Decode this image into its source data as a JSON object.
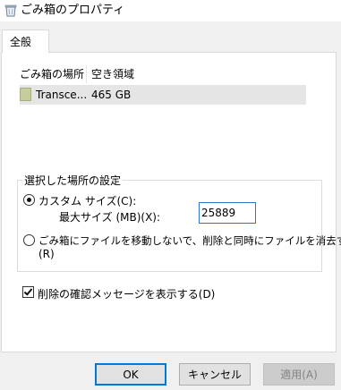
{
  "window": {
    "title": "ごみ箱のプロパティ",
    "icon": "recycle-bin-icon"
  },
  "tabs": [
    {
      "label": "全般",
      "selected": true
    }
  ],
  "list": {
    "columns": [
      "ごみ箱の場所",
      "空き領域"
    ],
    "rows": [
      {
        "location": "Transce...",
        "free_space": "465 GB",
        "icon": "drive-icon"
      }
    ]
  },
  "settings": {
    "group_title": "選択した場所の設定",
    "custom_size_label": "カスタム サイズ(C):",
    "custom_size_selected": true,
    "max_size_label": "最大サイズ (MB)(X):",
    "max_size_value": "25889",
    "no_move_label_line1": "ごみ箱にファイルを移動しないで、削除と同時にファイルを消去する",
    "no_move_label_line2": "(R)",
    "no_move_selected": false
  },
  "confirm_delete": {
    "label": "削除の確認メッセージを表示する(D)",
    "checked": true
  },
  "buttons": {
    "ok": "OK",
    "cancel": "キャンセル",
    "apply": "適用(A)"
  }
}
